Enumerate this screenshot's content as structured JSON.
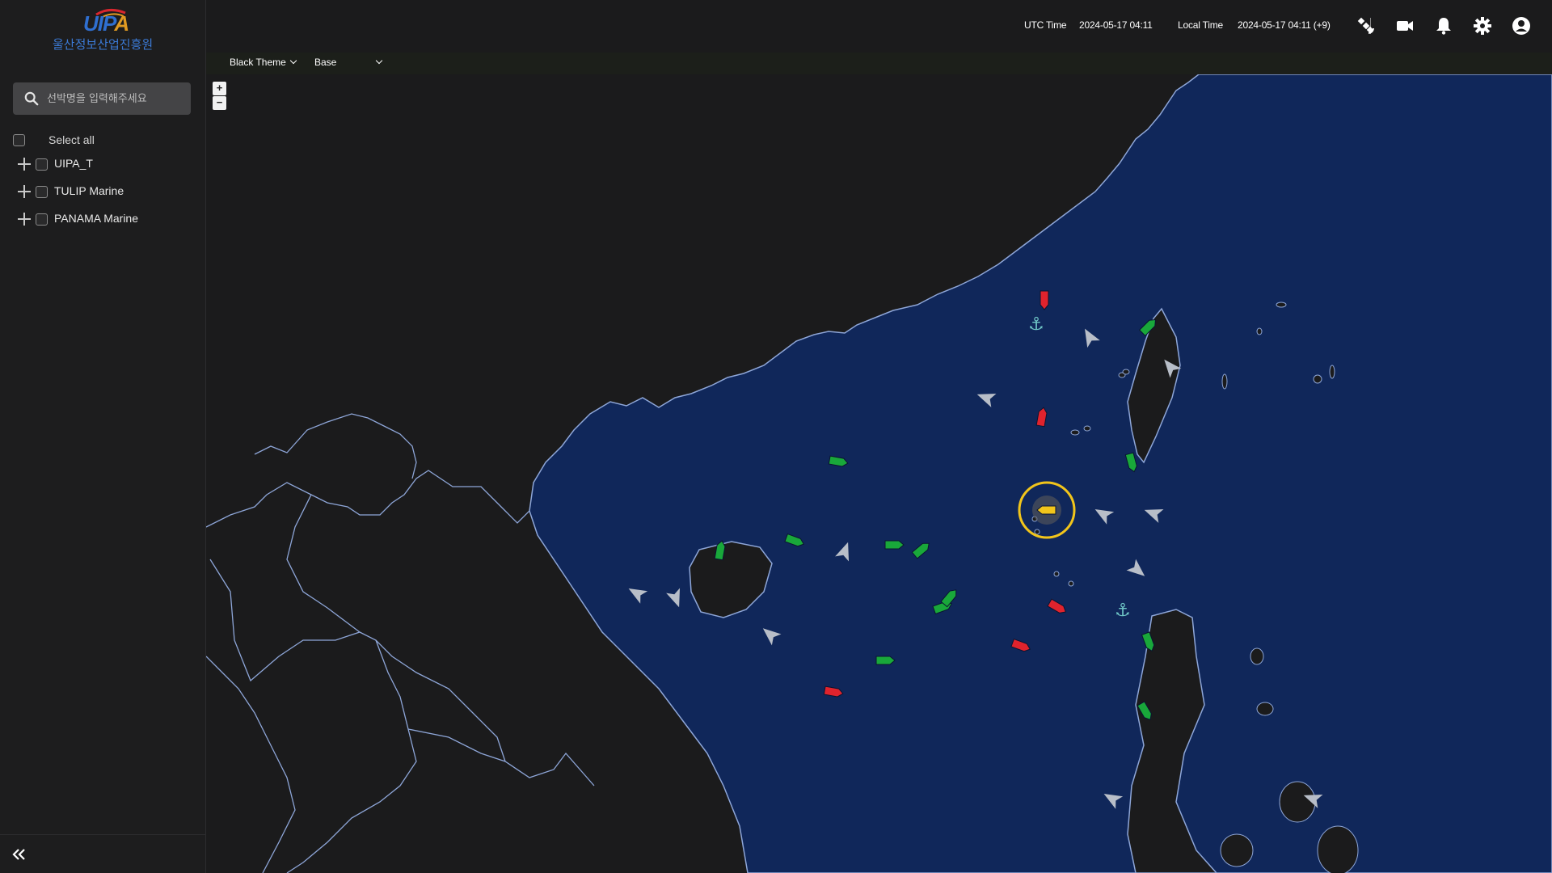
{
  "brand": {
    "logo_text_main": "UIP",
    "logo_text_accent": "A",
    "org_name": "울산정보산업진흥원"
  },
  "sidebar": {
    "search_placeholder": "선박명을 입력해주세요",
    "select_all_label": "Select all",
    "groups": [
      {
        "label": "UIPA_T"
      },
      {
        "label": "TULIP Marine"
      },
      {
        "label": "PANAMA Marine"
      }
    ]
  },
  "topbar": {
    "utc_label": "UTC Time",
    "utc_value": "2024-05-17 04:11",
    "local_label": "Local Time",
    "local_value": "2024-05-17 04:11 (+9)",
    "icons": [
      "satellite-icon",
      "video-camera-icon",
      "bell-icon",
      "gear-icon",
      "user-account-icon"
    ]
  },
  "map_controls": {
    "theme_value": "Black Theme",
    "layer_value": "Base",
    "zoom_in": "+",
    "zoom_out": "−"
  },
  "colors": {
    "sea": "#10275a",
    "land": "#1b1b1c",
    "coast": "#8ea6d8",
    "vessel_green": "#19a83a",
    "vessel_red": "#e0232d",
    "vessel_selected": "#f2c51b",
    "vessel_neutral": "#b8bec8",
    "anchor": "#6fc6c6"
  }
}
